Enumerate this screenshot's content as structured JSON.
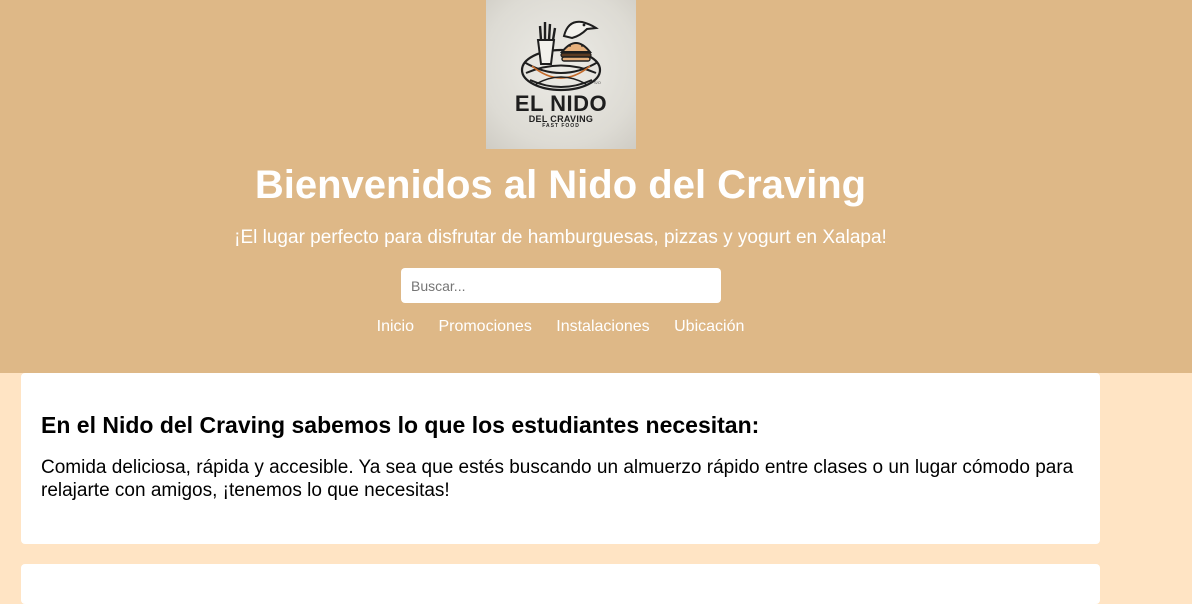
{
  "logo": {
    "line1": "EL NIDO",
    "line2": "DEL CRAVING",
    "line3": "FAST FOOD",
    "icon": "nest-fries-burger-bird-logo"
  },
  "header": {
    "title": "Bienvenidos al Nido del Craving",
    "subtitle": "¡El lugar perfecto para disfrutar de hamburguesas, pizzas y yogurt en Xalapa!"
  },
  "search": {
    "placeholder": "Buscar...",
    "value": ""
  },
  "nav": {
    "items": [
      {
        "label": "Inicio"
      },
      {
        "label": "Promociones"
      },
      {
        "label": "Instalaciones"
      },
      {
        "label": "Ubicación"
      }
    ]
  },
  "intro": {
    "heading": "En el Nido del Craving sabemos lo que los estudiantes necesitan:",
    "body": "Comida deliciosa, rápida y accesible. Ya sea que estés buscando un almuerzo rápido entre clases o un lugar cómodo para relajarte con amigos, ¡tenemos lo que necesitas!"
  },
  "colors": {
    "header_bg": "#deb887",
    "page_bg": "#ffe4c4",
    "card_bg": "#ffffff",
    "header_text": "#ffffff"
  }
}
